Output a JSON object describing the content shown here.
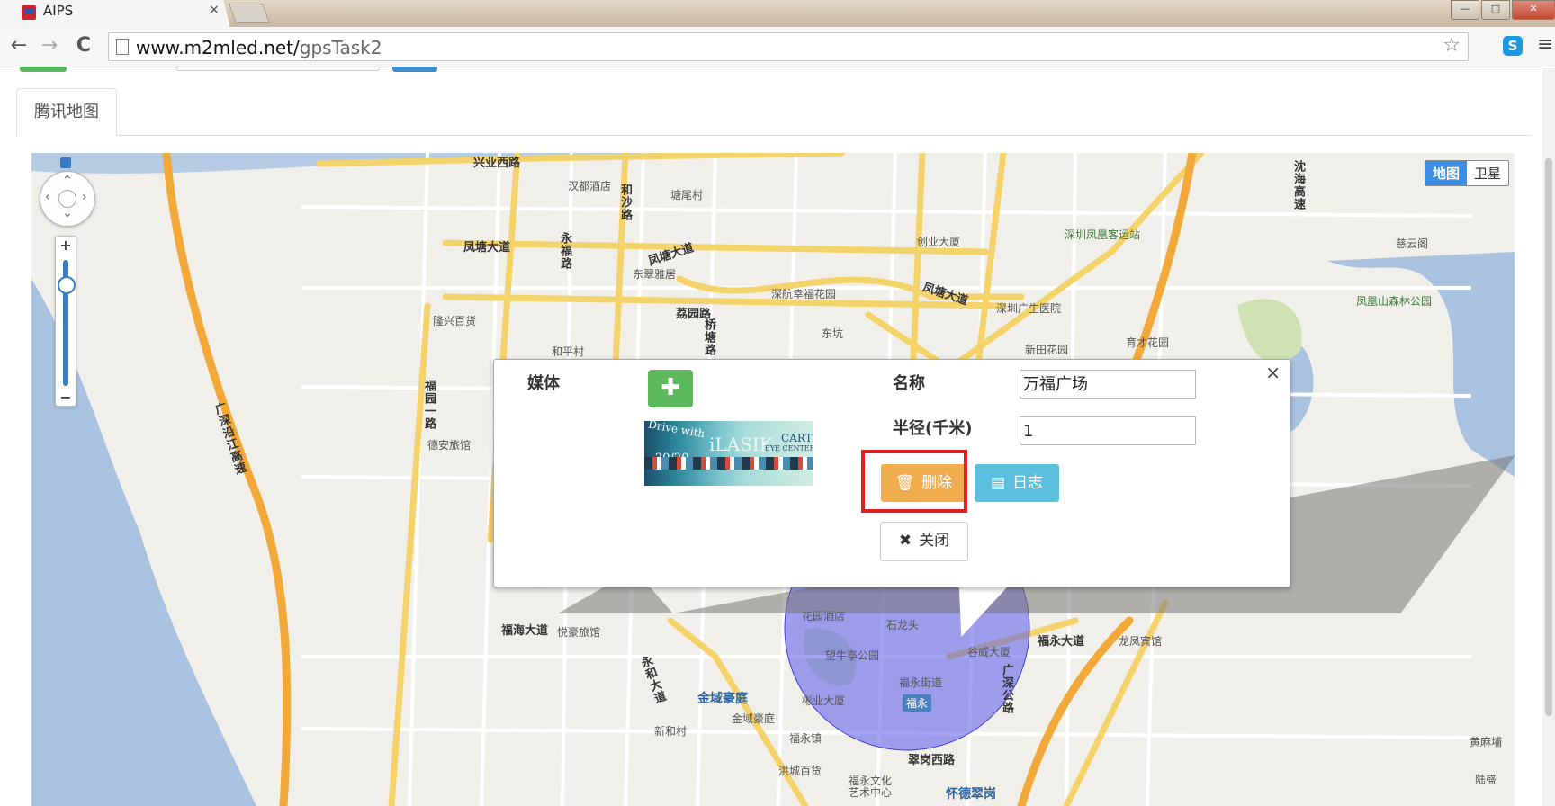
{
  "browser": {
    "tab_title": "AIPS",
    "tab_close": "×",
    "url_host": "www.m2mled.net/",
    "url_path": "gpsTask2",
    "back": "←",
    "forward": "→",
    "reload": "C",
    "star": "☆",
    "extension": "S",
    "menu": "≡",
    "window_controls": [
      "—",
      "□",
      "✕"
    ]
  },
  "page": {
    "map_tab": "腾讯地图"
  },
  "map": {
    "type_toggle": {
      "map": "地图",
      "satellite": "卫星",
      "active": "地图"
    },
    "zoom": {
      "plus": "+",
      "minus": "−"
    },
    "labels": [
      {
        "id": "xingye",
        "text": "兴业西路"
      },
      {
        "id": "handu",
        "text": "汉都酒店"
      },
      {
        "id": "heshalu",
        "text": "和沙路"
      },
      {
        "id": "tangweicun",
        "text": "塘尾村"
      },
      {
        "id": "fengtang1",
        "text": "凤塘大道"
      },
      {
        "id": "yongfulu",
        "text": "永福路"
      },
      {
        "id": "fengtang2",
        "text": "凤塘大道"
      },
      {
        "id": "dongcui",
        "text": "东翠雅居"
      },
      {
        "id": "chuangye",
        "text": "创业大厦"
      },
      {
        "id": "shenzhenfh",
        "text": "深圳凤凰客运站"
      },
      {
        "id": "ciyun",
        "text": "慈云阁"
      },
      {
        "id": "shenhang",
        "text": "深航幸福花园"
      },
      {
        "id": "lisilu",
        "text": "荔园路"
      },
      {
        "id": "qiaotanglu",
        "text": "桥塘路"
      },
      {
        "id": "fengtang3",
        "text": "凤塘大道"
      },
      {
        "id": "guangsheng",
        "text": "深圳广生医院"
      },
      {
        "id": "fenghuangshan",
        "text": "凤凰山森林公园"
      },
      {
        "id": "longxing",
        "text": "隆兴百货"
      },
      {
        "id": "dongkeng",
        "text": "东坑"
      },
      {
        "id": "hepingcun",
        "text": "和平村"
      },
      {
        "id": "xintian",
        "text": "新田花园"
      },
      {
        "id": "yucai",
        "text": "育才花园"
      },
      {
        "id": "fuyuanyilu",
        "text": "福园一路"
      },
      {
        "id": "dean",
        "text": "德安旅馆"
      },
      {
        "id": "guangshen",
        "text": "广深沿江高速"
      },
      {
        "id": "shenhai",
        "text": "沈海高速"
      },
      {
        "id": "fuhai",
        "text": "福海大道"
      },
      {
        "id": "yuehao",
        "text": "悦豪旅馆"
      },
      {
        "id": "huayuan",
        "text": "花园酒店"
      },
      {
        "id": "shilongtou",
        "text": "石龙头"
      },
      {
        "id": "wangniuting",
        "text": "望牛亭公园"
      },
      {
        "id": "guwei",
        "text": "谷威大厦"
      },
      {
        "id": "fuyong_ave",
        "text": "福永大道"
      },
      {
        "id": "longfeng",
        "text": "龙凤宾馆"
      },
      {
        "id": "fuyongjiedao",
        "text": "福永街道"
      },
      {
        "id": "guangshen_road",
        "text": "广深公路"
      },
      {
        "id": "fuyong_badge",
        "text": "福永"
      },
      {
        "id": "heping_ave",
        "text": "永和大道"
      },
      {
        "id": "jinyu_blue",
        "text": "金域豪庭"
      },
      {
        "id": "jinyu",
        "text": "金域豪庭"
      },
      {
        "id": "binye",
        "text": "彬业大厦"
      },
      {
        "id": "xinhecun",
        "text": "新和村"
      },
      {
        "id": "fuyongzhen",
        "text": "福永镇"
      },
      {
        "id": "cuigang",
        "text": "翠岗西路"
      },
      {
        "id": "hongcheng",
        "text": "洪城百货"
      },
      {
        "id": "fuyongwenhua",
        "text": "福永文化艺术中心"
      },
      {
        "id": "huaide",
        "text": "怀德翠岗"
      },
      {
        "id": "huangmapu",
        "text": "黄麻埔"
      },
      {
        "id": "lusheng",
        "text": "陆盛"
      }
    ]
  },
  "info_window": {
    "media_label": "媒体",
    "add_button": "✚",
    "name_label": "名称",
    "name_value": "万福广场",
    "radius_label": "半径(千米)",
    "radius_value": "1",
    "delete_button": "删除",
    "log_button": "日志",
    "close_button": "关闭",
    "close_x": "×",
    "thumb": {
      "t1": "Drive with",
      "t2": "iLASIK",
      "t3": "CARTER",
      "t4": "EYE CENTER",
      "t5": "20/20"
    }
  }
}
